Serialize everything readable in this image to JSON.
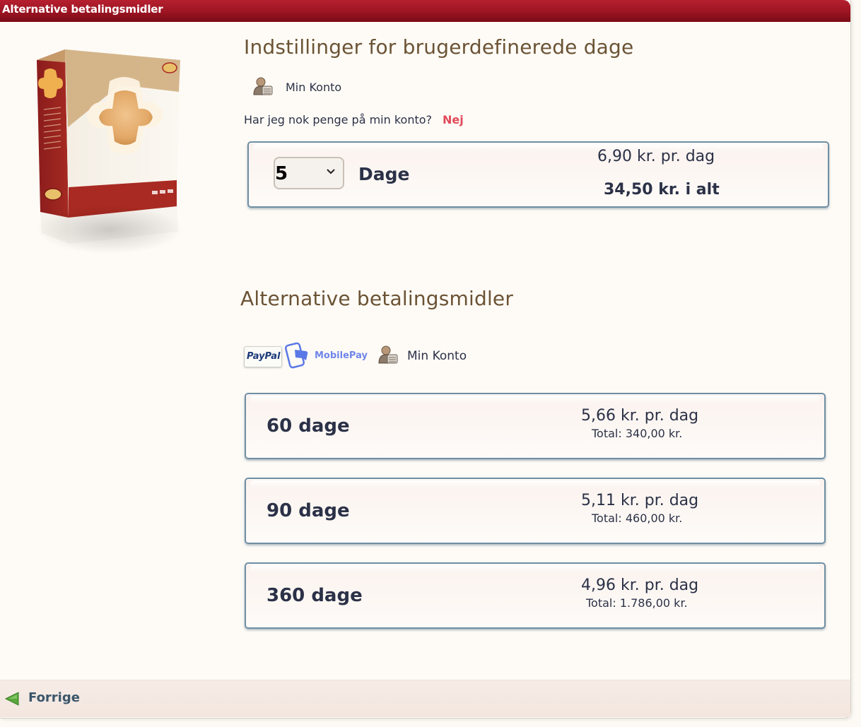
{
  "window": {
    "title": "Alternative betalingsmidler"
  },
  "custom": {
    "heading": "Indstillinger for brugerdefinerede dage",
    "account_label": "Min Konto",
    "question": "Har jeg nok penge på min konto?",
    "answer": "Nej",
    "selected_days": "5",
    "days_label": "Dage",
    "price_per_day": "6,90 kr. pr. dag",
    "price_total": "34,50 kr. i alt"
  },
  "alternative": {
    "heading": "Alternative betalingsmidler",
    "methods": {
      "paypal": "PayPal",
      "mobilepay": "MobilePay",
      "account": "Min Konto"
    },
    "plans": [
      {
        "days": "60 dage",
        "per_day": "5,66 kr. pr. dag",
        "total": "Total: 340,00 kr."
      },
      {
        "days": "90 dage",
        "per_day": "5,11 kr. pr. dag",
        "total": "Total: 460,00 kr."
      },
      {
        "days": "360 dage",
        "per_day": "4,96 kr. pr. dag",
        "total": "Total: 1.786,00 kr."
      }
    ]
  },
  "footer": {
    "back_label": "Forrige"
  },
  "colors": {
    "titlebar": "#9c1422",
    "heading": "#6b5335",
    "accent_no": "#e04a5a",
    "card_border": "#6f8ea3"
  }
}
